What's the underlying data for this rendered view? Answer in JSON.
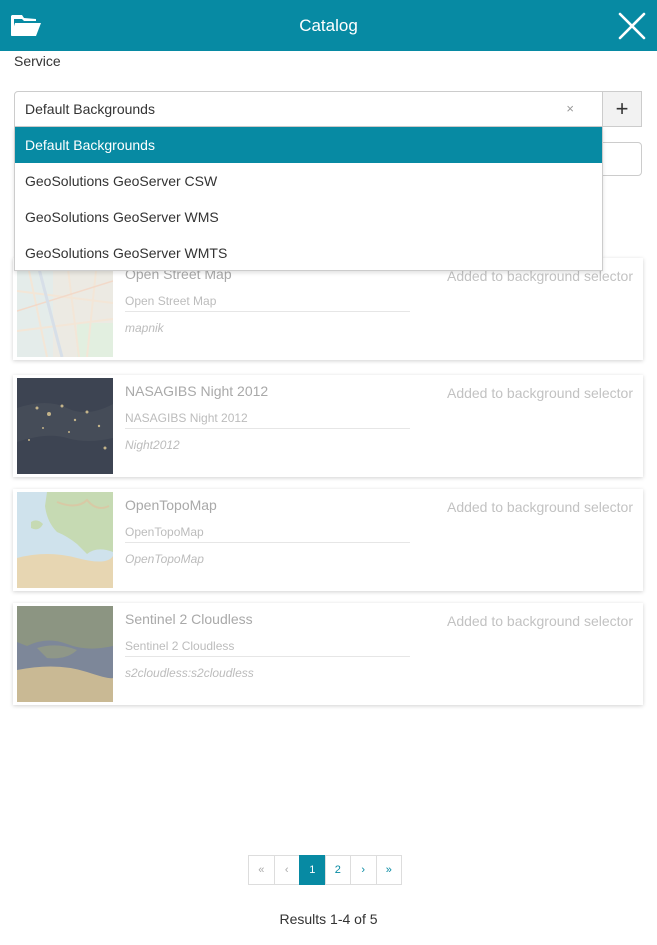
{
  "header": {
    "title": "Catalog",
    "open_icon": "folder-open-icon",
    "close_icon": "close-icon",
    "color": "#078aa3"
  },
  "service": {
    "label": "Service",
    "selected": "Default Backgrounds",
    "clear": "×",
    "add": "+",
    "options": [
      "Default Backgrounds",
      "GeoSolutions GeoServer CSW",
      "GeoSolutions GeoServer WMS",
      "GeoSolutions GeoServer WMTS"
    ]
  },
  "records": [
    {
      "title": "Open Street Map",
      "description": "Open Street Map",
      "identifier": "mapnik",
      "status": "Added to background selector"
    },
    {
      "title": "NASAGIBS Night 2012",
      "description": "NASAGIBS Night 2012",
      "identifier": "Night2012",
      "status": "Added to background selector"
    },
    {
      "title": "OpenTopoMap",
      "description": "OpenTopoMap",
      "identifier": "OpenTopoMap",
      "status": "Added to background selector"
    },
    {
      "title": "Sentinel 2 Cloudless",
      "description": "Sentinel 2 Cloudless",
      "identifier": "s2cloudless:s2cloudless",
      "status": "Added to background selector"
    }
  ],
  "pagination": {
    "first": "«",
    "prev": "‹",
    "pages": [
      "1",
      "2"
    ],
    "next": "›",
    "last": "»",
    "current": "1"
  },
  "results": "Results 1-4 of 5"
}
